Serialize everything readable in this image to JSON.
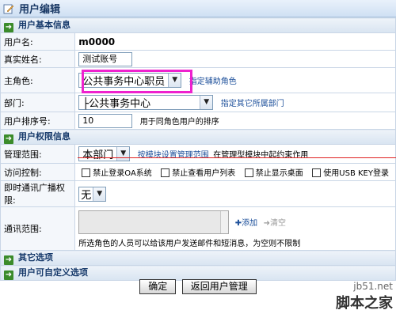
{
  "header": {
    "title": "用户编辑"
  },
  "sections": {
    "basic": "用户基本信息",
    "permissions": "用户权限信息",
    "other": "其它选项",
    "custom": "用户可自定义选项"
  },
  "fields": {
    "username": {
      "label": "用户名:",
      "value": "m0000"
    },
    "realname": {
      "label": "真实姓名:",
      "value": "测试账号"
    },
    "main_role": {
      "label": "主角色:",
      "value": "公共事务中心职员",
      "link": "指定辅助角色"
    },
    "department": {
      "label": "部门:",
      "value": "├公共事务中心",
      "link": "指定其它所属部门"
    },
    "sort_order": {
      "label": "用户排序号:",
      "value": "10",
      "hint": "用于同角色用户的排序"
    },
    "scope": {
      "label": "管理范围:",
      "value": "本部门",
      "link": "按模块设置管理范围",
      "note": "在管理型模块中起约束作用"
    },
    "access": {
      "label": "访问控制:",
      "options": [
        "禁止登录OA系统",
        "禁止查看用户列表",
        "禁止显示桌面",
        "使用USB KEY登录"
      ]
    },
    "im": {
      "label": "即时通讯广播权限:",
      "value": "无"
    },
    "comm": {
      "label": "通讯范围:",
      "add": "添加",
      "clear": "清空",
      "note": "所选角色的人员可以给该用户发送邮件和短消息，为空则不限制"
    }
  },
  "buttons": {
    "confirm": "确定",
    "back": "返回用户管理"
  },
  "watermark": {
    "site": "jb51.net",
    "name": "脚本之家"
  },
  "colors": {
    "highlight": "#ee22ce",
    "accent_line": "#e02020",
    "section_icon": "#3b8b2a"
  }
}
